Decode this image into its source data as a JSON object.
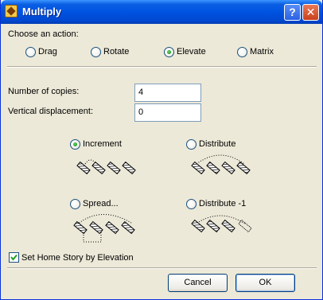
{
  "window": {
    "title": "Multiply",
    "help_glyph": "?",
    "close_glyph": "✕"
  },
  "action": {
    "label": "Choose an action:",
    "options": [
      {
        "label": "Drag",
        "selected": false
      },
      {
        "label": "Rotate",
        "selected": false
      },
      {
        "label": "Elevate",
        "selected": true
      },
      {
        "label": "Matrix",
        "selected": false
      }
    ]
  },
  "fields": {
    "copies_label": "Number of copies:",
    "copies_value": "4",
    "displacement_label": "Vertical displacement:",
    "displacement_value": "0"
  },
  "modes": [
    {
      "label": "Increment",
      "selected": true
    },
    {
      "label": "Distribute",
      "selected": false
    },
    {
      "label": "Spread...",
      "selected": false
    },
    {
      "label": "Distribute -1",
      "selected": false
    }
  ],
  "home_story": {
    "label": "Set Home Story by Elevation",
    "checked": true
  },
  "buttons": {
    "cancel": "Cancel",
    "ok": "OK"
  }
}
